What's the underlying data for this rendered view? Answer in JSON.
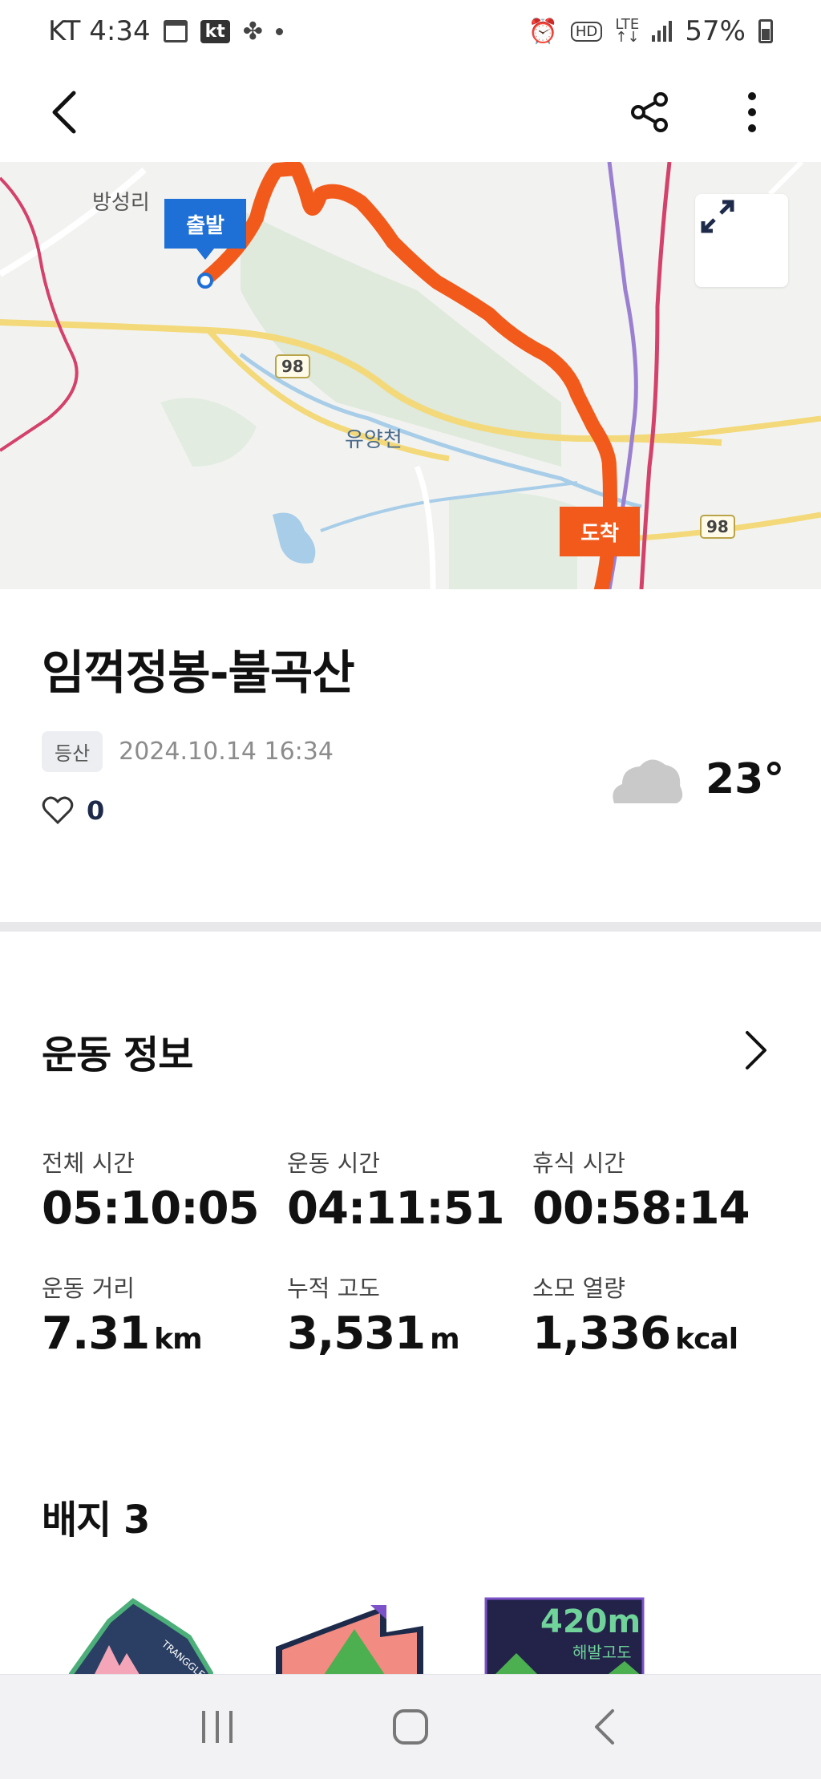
{
  "status_bar": {
    "carrier_time": "KT 4:34",
    "kt_badge": "kt",
    "lte": "LTE",
    "hd": "HD",
    "battery": "57%"
  },
  "app_bar": {
    "icons": [
      "back-arrow",
      "share",
      "more-vertical"
    ]
  },
  "map": {
    "place_labels": [
      "방성리",
      "유양천"
    ],
    "road_number": "98",
    "start_label": "출발",
    "end_label": "도착",
    "colors": {
      "route": "#f25a1c",
      "start_pin": "#1e6fd6",
      "end_pin": "#f25a1c"
    }
  },
  "activity": {
    "title": "임꺽정봉-불곡산",
    "category": "등산",
    "datetime": "2024.10.14 16:34",
    "likes": "0",
    "weather_icon": "cloud",
    "temperature": "23°"
  },
  "exercise_info": {
    "heading": "운동 정보",
    "stats": [
      {
        "label": "전체 시간",
        "value": "05:10:05",
        "unit": ""
      },
      {
        "label": "운동 시간",
        "value": "04:11:51",
        "unit": ""
      },
      {
        "label": "휴식 시간",
        "value": "00:58:14",
        "unit": ""
      },
      {
        "label": "운동 거리",
        "value": "7.31",
        "unit": "km"
      },
      {
        "label": "누적 고도",
        "value": "3,531",
        "unit": "m"
      },
      {
        "label": "소모 열량",
        "value": "1,336",
        "unit": "kcal"
      }
    ]
  },
  "badges": {
    "heading": "배지 3",
    "items": [
      {
        "text": "TRANGGLE",
        "color": "#2a3f63"
      },
      {
        "text": "",
        "color": "#f28b82"
      },
      {
        "value": "420m",
        "label": "해발고도",
        "color": "#23234a"
      }
    ]
  }
}
